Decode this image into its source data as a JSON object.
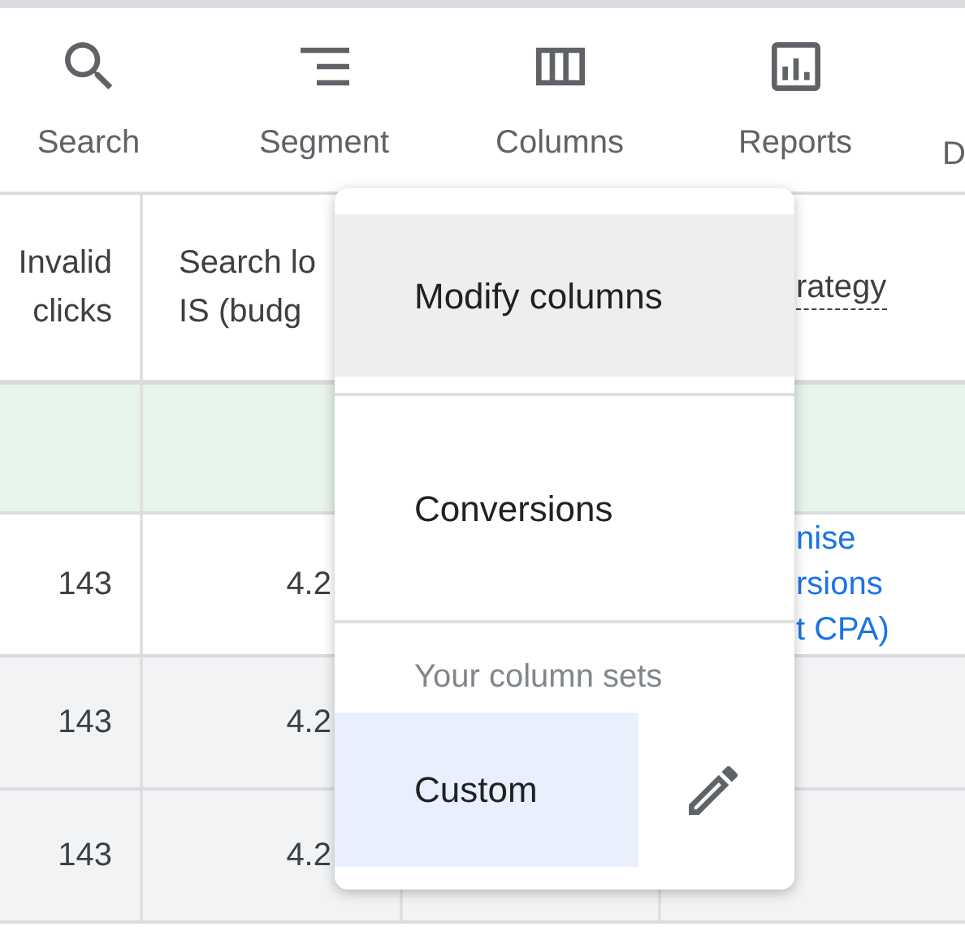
{
  "toolbar": {
    "items": [
      {
        "label": "Search"
      },
      {
        "label": "Segment"
      },
      {
        "label": "Columns"
      },
      {
        "label": "Reports"
      },
      {
        "label": "D"
      }
    ]
  },
  "table": {
    "columns": [
      {
        "lines": [
          "Invalid",
          "clicks"
        ]
      },
      {
        "lines": [
          "Search lo",
          "IS (budg"
        ]
      },
      {},
      {
        "lines": [
          "rategy"
        ]
      }
    ],
    "rows": [
      {
        "kind": "summary",
        "cells": []
      },
      {
        "kind": "data",
        "shaded": false,
        "cells": [
          "143",
          "4.2"
        ],
        "strategy": [
          "nise",
          "rsions",
          "t CPA)"
        ]
      },
      {
        "kind": "data",
        "shaded": true,
        "cells": [
          "143",
          "4.2"
        ]
      },
      {
        "kind": "data",
        "shaded": true,
        "cells": [
          "143",
          "4.2"
        ]
      }
    ]
  },
  "menu": {
    "items": [
      {
        "kind": "option",
        "label": "Modify columns",
        "highlighted": true
      },
      {
        "kind": "option",
        "label": "Conversions",
        "highlighted": false
      },
      {
        "kind": "heading",
        "label": "Your column sets"
      },
      {
        "kind": "column_set",
        "label": "Custom",
        "selected": true
      }
    ]
  }
}
